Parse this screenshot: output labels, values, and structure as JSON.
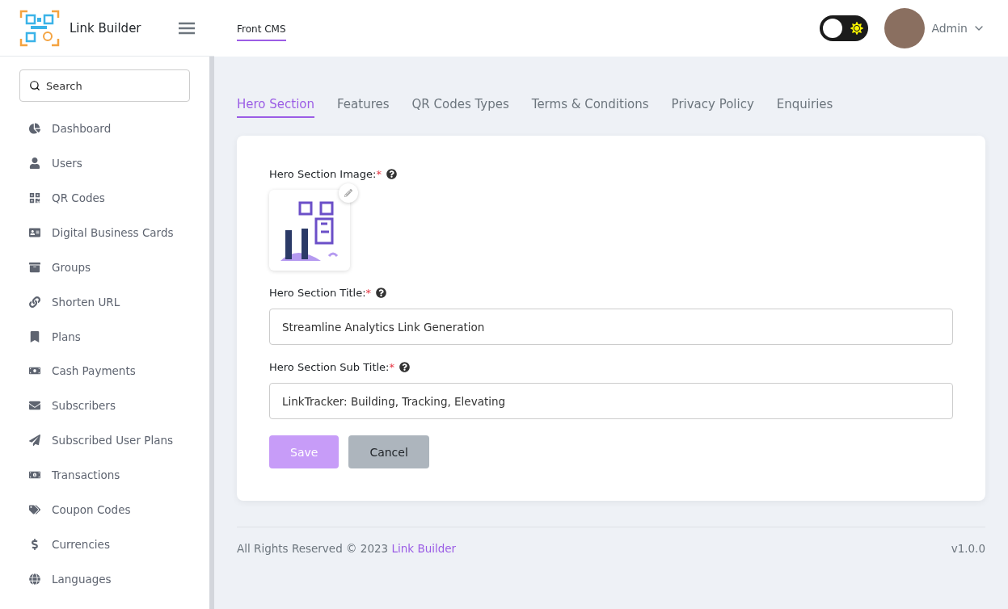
{
  "brand": {
    "name": "Link Builder"
  },
  "header": {
    "nav": [
      {
        "label": "Front CMS",
        "selected": true
      }
    ],
    "theme_toggle": {
      "on": false
    },
    "user": {
      "name": "Admin"
    }
  },
  "sidebar": {
    "search": {
      "placeholder": "Search"
    },
    "items": [
      {
        "label": "Dashboard",
        "selected": false
      },
      {
        "label": "Users",
        "selected": false
      },
      {
        "label": "QR Codes",
        "selected": false
      },
      {
        "label": "Digital Business Cards",
        "selected": false
      },
      {
        "label": "Groups",
        "selected": false
      },
      {
        "label": "Shorten URL",
        "selected": false
      },
      {
        "label": "Plans",
        "selected": false
      },
      {
        "label": "Cash Payments",
        "selected": false
      },
      {
        "label": "Subscribers",
        "selected": false
      },
      {
        "label": "Subscribed User Plans",
        "selected": false
      },
      {
        "label": "Transactions",
        "selected": false
      },
      {
        "label": "Coupon Codes",
        "selected": false
      },
      {
        "label": "Currencies",
        "selected": false
      },
      {
        "label": "Languages",
        "selected": false
      }
    ]
  },
  "tabs": [
    {
      "label": "Hero Section",
      "selected": true
    },
    {
      "label": "Features",
      "selected": false
    },
    {
      "label": "QR Codes Types",
      "selected": false
    },
    {
      "label": "Terms & Conditions",
      "selected": false
    },
    {
      "label": "Privacy Policy",
      "selected": false
    },
    {
      "label": "Enquiries",
      "selected": false
    }
  ],
  "form": {
    "fields": [
      {
        "kind": "image",
        "label": "Hero Section Image:",
        "required_mark": "*"
      },
      {
        "kind": "text",
        "label": "Hero Section Title:",
        "required_mark": "*",
        "value": "Streamline Analytics Link Generation"
      },
      {
        "kind": "text",
        "label": "Hero Section Sub Title:",
        "required_mark": "*",
        "value": "LinkTracker: Building, Tracking, Elevating"
      }
    ],
    "buttons": [
      {
        "kind": "primary",
        "label": "Save",
        "disabled": true
      },
      {
        "kind": "secondary",
        "label": "Cancel"
      }
    ]
  },
  "footer": {
    "text": "All Rights Reserved © 2023",
    "link": "Link Builder",
    "version": "v1.0.0"
  }
}
